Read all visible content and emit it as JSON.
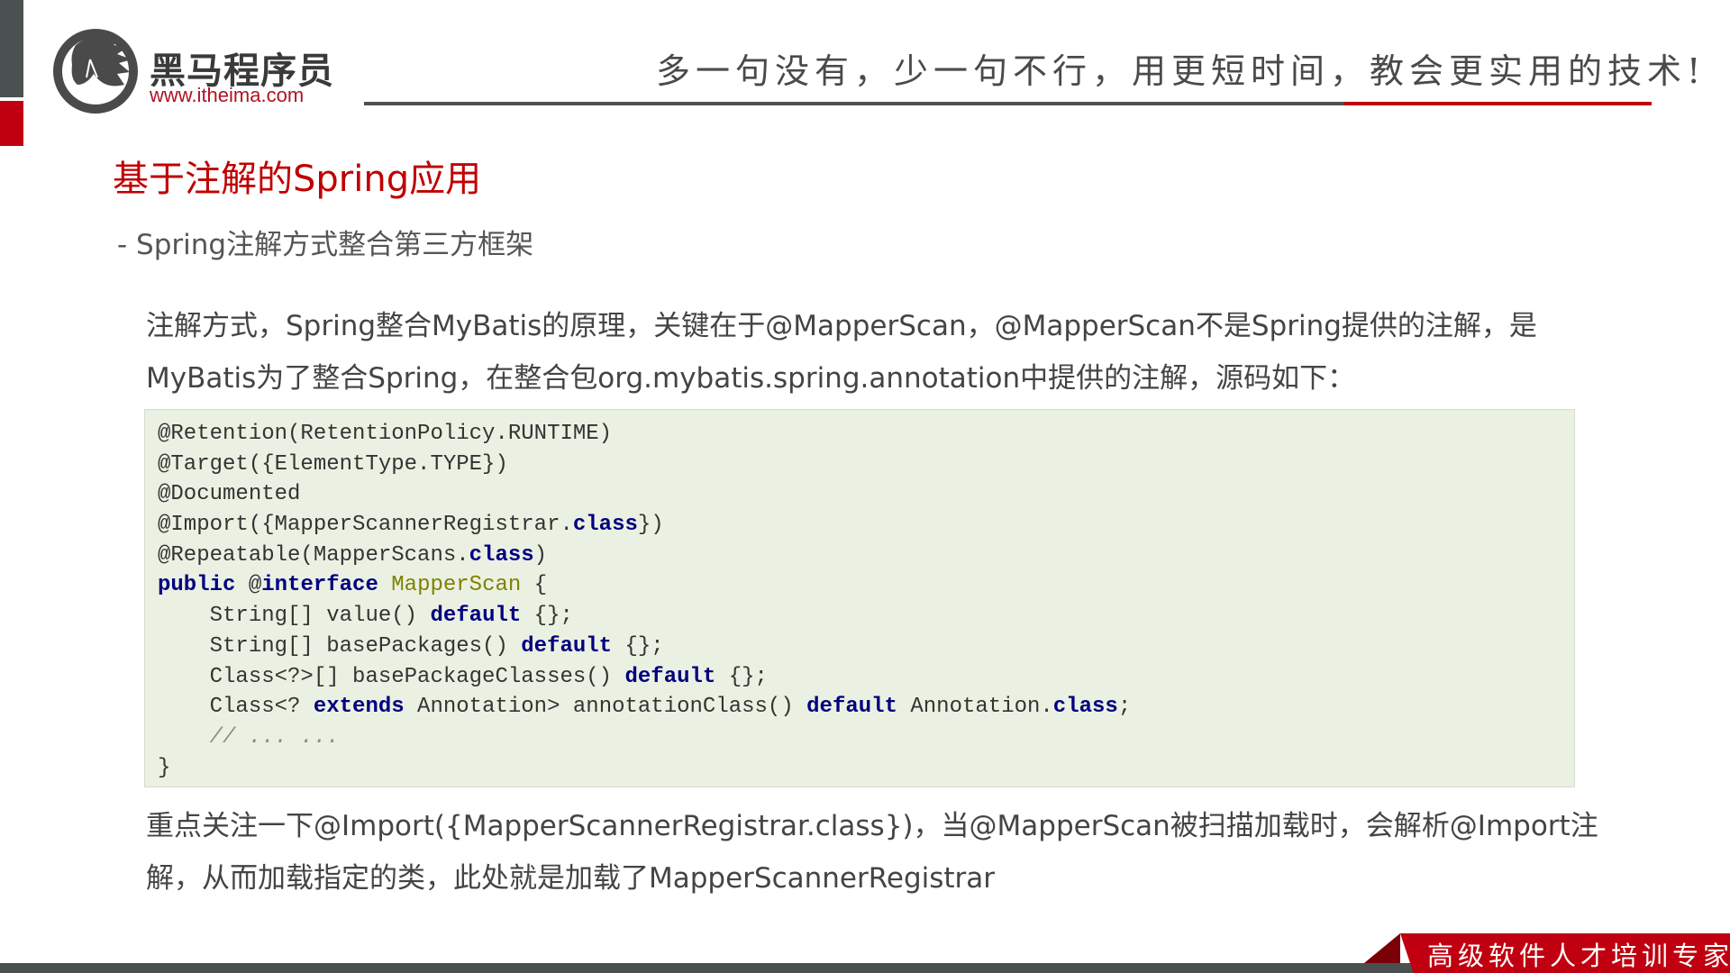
{
  "brand": {
    "logo_icon": "horse-head-circle-logo",
    "name": "黑马程序员",
    "url": "www.itheima.com",
    "slogan": "多一句没有，少一句不行，用更短时间，教会更实用的技术!",
    "colors": {
      "red": "#c00010",
      "grey": "#4b5050"
    }
  },
  "slide": {
    "title": "基于注解的Spring应用",
    "subtitle": "- Spring注解方式整合第三方框架",
    "paragraph1": [
      "注解方式，Spring整合MyBatis的原理，关键在于@MapperScan，@MapperScan不是Spring提供的注解，是",
      "MyBatis为了整合Spring，在整合包org.mybatis.spring.annotation中提供的注解，源码如下："
    ],
    "code": [
      [
        {
          "t": "@Retention(RetentionPolicy.RUNTIME)",
          "k": ""
        }
      ],
      [
        {
          "t": "@Target({ElementType.TYPE})",
          "k": ""
        }
      ],
      [
        {
          "t": "@Documented",
          "k": ""
        }
      ],
      [
        {
          "t": "@Import({MapperScannerRegistrar.",
          "k": ""
        },
        {
          "t": "class",
          "k": "kw"
        },
        {
          "t": "})",
          "k": ""
        }
      ],
      [
        {
          "t": "@Repeatable(MapperScans.",
          "k": ""
        },
        {
          "t": "class",
          "k": "kw"
        },
        {
          "t": ")",
          "k": ""
        }
      ],
      [
        {
          "t": "public",
          "k": "kw"
        },
        {
          "t": " @",
          "k": ""
        },
        {
          "t": "interface",
          "k": "kw"
        },
        {
          "t": " ",
          "k": ""
        },
        {
          "t": "MapperScan",
          "k": "cls"
        },
        {
          "t": " {",
          "k": ""
        }
      ],
      [
        {
          "t": "    String[] value() ",
          "k": ""
        },
        {
          "t": "default",
          "k": "kw"
        },
        {
          "t": " {};",
          "k": ""
        }
      ],
      [
        {
          "t": "    String[] basePackages() ",
          "k": ""
        },
        {
          "t": "default",
          "k": "kw"
        },
        {
          "t": " {};",
          "k": ""
        }
      ],
      [
        {
          "t": "    Class<?>[] basePackageClasses() ",
          "k": ""
        },
        {
          "t": "default",
          "k": "kw"
        },
        {
          "t": " {};",
          "k": ""
        }
      ],
      [
        {
          "t": "    Class<? ",
          "k": ""
        },
        {
          "t": "extends",
          "k": "kw"
        },
        {
          "t": " Annotation> annotationClass() ",
          "k": ""
        },
        {
          "t": "default",
          "k": "kw"
        },
        {
          "t": " Annotation.",
          "k": ""
        },
        {
          "t": "class",
          "k": "kw"
        },
        {
          "t": ";",
          "k": ""
        }
      ],
      [
        {
          "t": "    // ... ...",
          "k": "cm"
        }
      ],
      [
        {
          "t": "}",
          "k": ""
        }
      ]
    ],
    "paragraph2": [
      "重点关注一下@Import({MapperScannerRegistrar.class})，当@MapperScan被扫描加载时，会解析@Import注",
      "解，从而加载指定的类，此处就是加载了MapperScannerRegistrar"
    ]
  },
  "footer": {
    "tagline": "高级软件人才培训专家"
  }
}
